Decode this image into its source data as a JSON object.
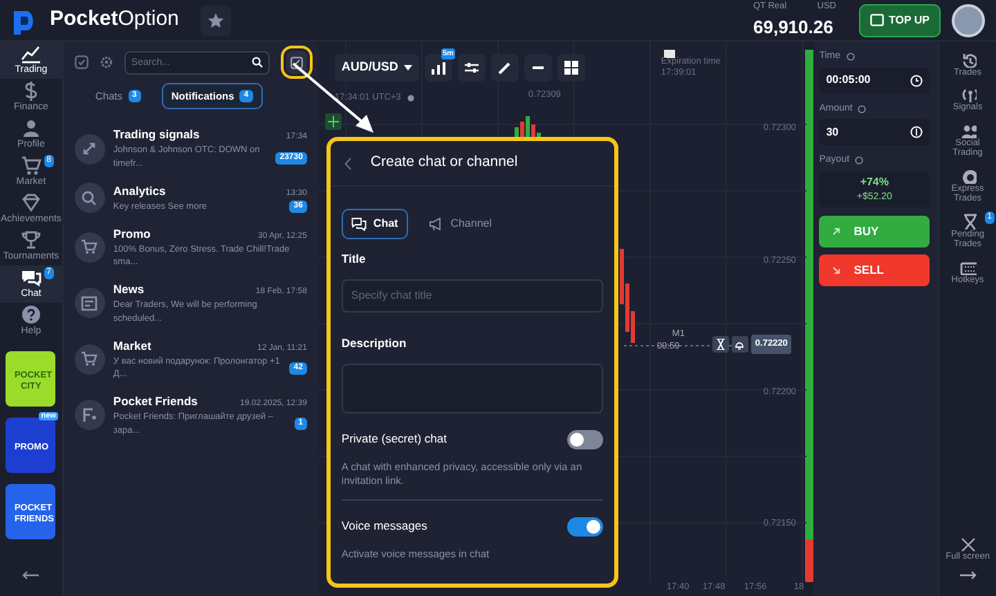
{
  "header": {
    "logo": "**Pocket**Option",
    "account_type": "QT Real",
    "currency": "USD",
    "balance": "69,910.26",
    "top_up": "TOP UP"
  },
  "nav": [
    {
      "label": "Trading",
      "selected": true
    },
    {
      "label": "Finance",
      "selected": false
    },
    {
      "label": "Profile",
      "selected": false
    },
    {
      "label": "Market",
      "selected": false,
      "badge": "8"
    },
    {
      "label": "Achievements",
      "selected": false
    },
    {
      "label": "Tournaments",
      "selected": false
    },
    {
      "label": "Chat",
      "selected": true,
      "badge": "7"
    },
    {
      "label": "Help",
      "selected": false
    }
  ],
  "promos": [
    {
      "label": "POCKET CITY",
      "color": "#9bdc2a"
    },
    {
      "label": "PROMO",
      "tag": "new",
      "color": "#1d3fd1"
    },
    {
      "label": "POCKET FRIENDS",
      "color": "#2563eb"
    }
  ],
  "chat_panel": {
    "search_placeholder": "Search...",
    "tabs": [
      {
        "label": "Chats",
        "count": "3",
        "selected": false
      },
      {
        "label": "Notifications",
        "count": "4",
        "selected": true
      }
    ],
    "items": [
      {
        "name": "Trading signals",
        "preview": "Johnson & Johnson OTC: DOWN on timefr...",
        "time": "17:34",
        "badge": "23730"
      },
      {
        "name": "Analytics",
        "preview": "Key releases See more",
        "time": "13:30",
        "badge": "36"
      },
      {
        "name": "Promo",
        "preview": "100% Bonus, Zero Stress. Trade Chill!Trade sma...",
        "time": "30 Apr, 12:25"
      },
      {
        "name": "News",
        "preview": "Dear Traders, We will be performing scheduled...",
        "time": "18 Feb, 17:58"
      },
      {
        "name": "Market",
        "preview": "У вас новий подарунок: Пролонгатор +1 Д...",
        "time": "12 Jan, 11:21",
        "badge": "42"
      },
      {
        "name": "Pocket Friends",
        "preview": "Pocket Friends: Приглашайте друзей – зара...",
        "time": "19.02.2025, 12:39",
        "badge": "1"
      }
    ]
  },
  "chart": {
    "pair": "AUD/USD",
    "interval_badge": "5m",
    "clock": "17:34:01 UTC+3",
    "expiration_label": "Expiration time",
    "expiration_time": "17:39:01",
    "high_label": "0.72309",
    "price_labels": [
      "0.72300",
      "0.72250",
      "0.72200",
      "0.72150"
    ],
    "current_price": "0.72220",
    "candle_label": "M1",
    "candle_timer": "00:59",
    "time_labels": [
      "17:40",
      "17:48",
      "17:56",
      "18"
    ],
    "sentiment": {
      "level": 0.92
    }
  },
  "trade": {
    "time_label": "Time",
    "time": "00:05:00",
    "amount_label": "Amount",
    "amount": "30",
    "payout_label": "Payout",
    "payout_percent": "+74%",
    "payout_amount": "+$52.20",
    "buy": "BUY",
    "sell": "SELL"
  },
  "right_nav": [
    {
      "label": "Trades"
    },
    {
      "label": "Signals"
    },
    {
      "label": "Social Trading"
    },
    {
      "label": "Express Trades"
    },
    {
      "label": "Pending Trades",
      "badge": "1"
    },
    {
      "label": "Hotkeys"
    }
  ],
  "full_screen": "Full screen",
  "dialog": {
    "title": "Create chat or channel",
    "tabs": [
      {
        "label": "Chat",
        "selected": true
      },
      {
        "label": "Channel",
        "selected": false
      }
    ],
    "title_label": "Title",
    "title_placeholder": "Specify chat title",
    "description_label": "Description",
    "options": [
      {
        "label": "Private (secret) chat",
        "on": false,
        "hint": "A chat with enhanced privacy, accessible only via an invitation link."
      },
      {
        "label": "Voice messages",
        "on": true,
        "hint": "Activate voice messages in chat"
      }
    ]
  }
}
